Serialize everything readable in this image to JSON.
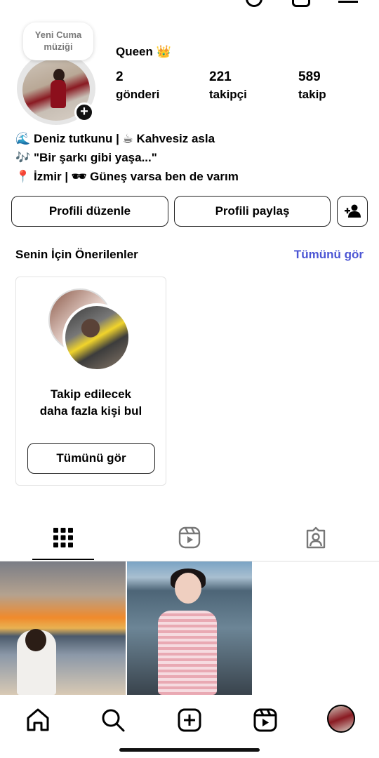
{
  "profile": {
    "username": "Queen 👑",
    "note_line1": "Yeni Cuma",
    "note_line2": "müziği",
    "stats": {
      "posts_count": "2",
      "posts_label": "gönderi",
      "followers_count": "221",
      "followers_label": "takipçi",
      "following_count": "589",
      "following_label": "takip"
    },
    "bio": {
      "line1_emoji": "🌊",
      "line1_text": "Deniz tutkunu | ☕ Kahvesiz asla",
      "line2_emoji": "🎶",
      "line2_text": "\"Bir şarkı gibi yaşa...\"",
      "line3_emoji": "📍",
      "line3_text": "İzmir | 🕶 Güneş varsa ben de varım"
    }
  },
  "actions": {
    "edit_label": "Profili düzenle",
    "share_label": "Profili paylaş"
  },
  "suggestions": {
    "title": "Senin İçin Önerilenler",
    "see_all": "Tümünü gör",
    "card_text_line1": "Takip edilecek",
    "card_text_line2": "daha fazla kişi bul",
    "card_button": "Tümünü gör"
  },
  "colors": {
    "link_blue": "#4b55d4",
    "border": "#222222"
  },
  "icons": {
    "tabs": [
      "grid-icon",
      "reels-icon",
      "tagged-icon"
    ],
    "nav": [
      "home-icon",
      "search-icon",
      "create-icon",
      "reels-icon",
      "profile-avatar"
    ]
  }
}
